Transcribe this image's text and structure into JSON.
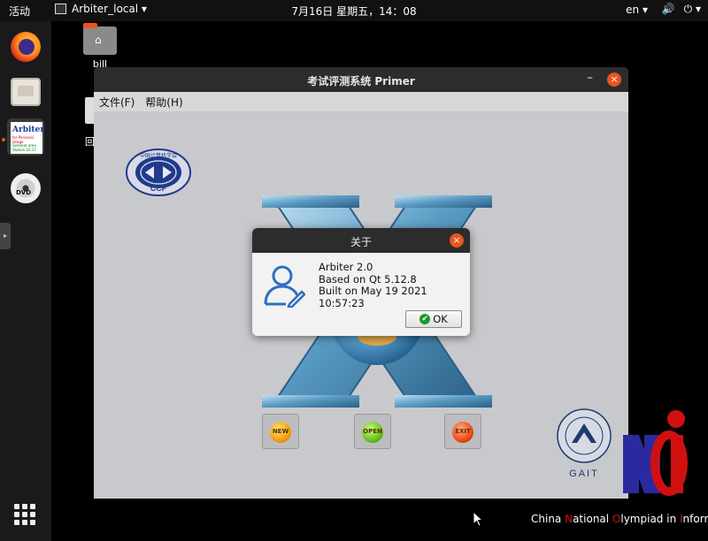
{
  "topbar": {
    "activities": "活动",
    "app_name": "Arbiter_local ▾",
    "clock": "7月16日 星期五，14：08",
    "lang": "en ▾",
    "tray": [
      "🔊",
      "⏻ ▾"
    ]
  },
  "dock": {
    "items": [
      {
        "name": "firefox-icon"
      },
      {
        "name": "files-icon"
      },
      {
        "name": "arbiter-icon",
        "title": "Arbiter",
        "subtitle": "for Personal Usage",
        "lines": [
          "Seminar area",
          "Station 10.17"
        ]
      },
      {
        "name": "dvd-icon",
        "label": "DVD"
      },
      {
        "name": "show-applications-icon"
      }
    ]
  },
  "desktop": {
    "bill_label": "bill",
    "second_label": "回"
  },
  "main_window": {
    "title": "考试评测系统 Primer",
    "minimize": "–",
    "close": "×",
    "menu": [
      "文件(F)",
      "帮助(H)"
    ],
    "ccf_text": "CCF",
    "ccf_ring": "中国计算机学会",
    "buttons": {
      "new": "NEW",
      "open": "OPEN",
      "exit": "EXIT"
    },
    "gait_label": "GAIT"
  },
  "about_dialog": {
    "title": "关于",
    "close": "×",
    "line1": "Arbiter 2.0",
    "line2": "Based on Qt 5.12.8",
    "line3": "Built on May 19 2021 10:57:23",
    "ok": "OK"
  },
  "noi": {
    "text_parts": [
      "China ",
      "N",
      "ational ",
      "O",
      "lympiad in ",
      "I",
      "nformatics"
    ]
  },
  "colors": {
    "accent": "#e95420",
    "window_bg": "#c8c9cc",
    "titlebar": "#2c2c2c"
  }
}
